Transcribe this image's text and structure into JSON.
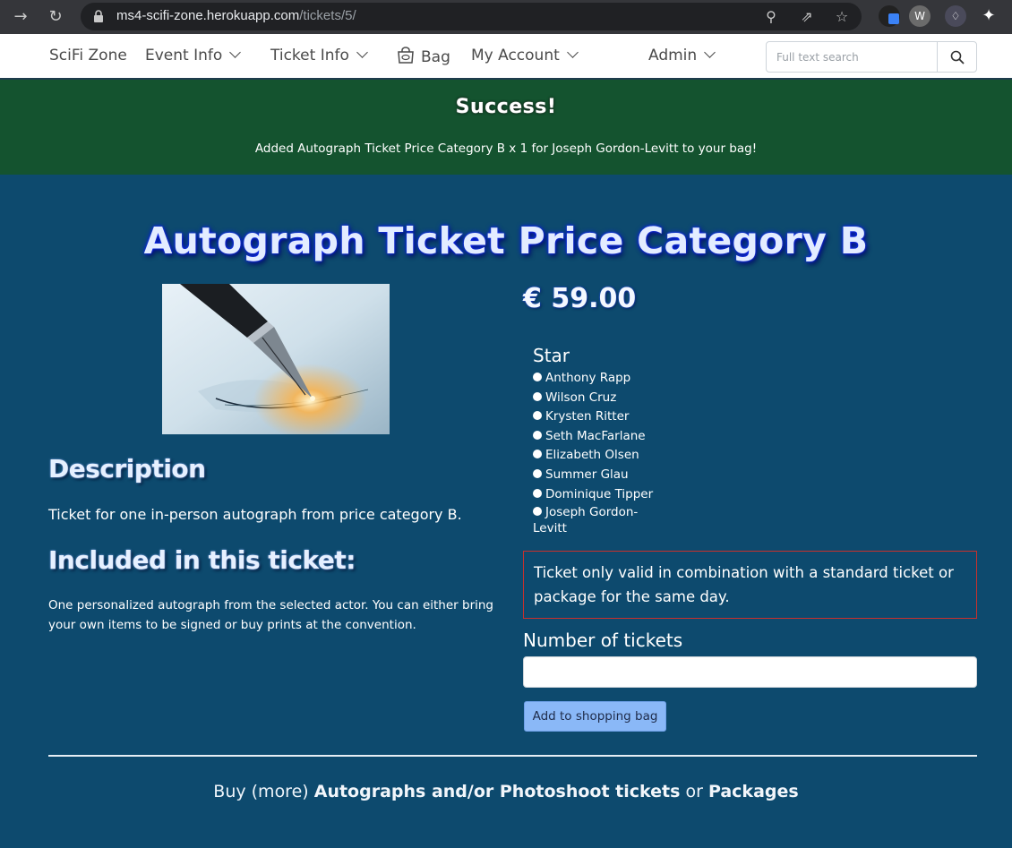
{
  "browser": {
    "url_host": "ms4-scifi-zone.herokuapp.com",
    "url_path": "/tickets/5/"
  },
  "navbar": {
    "brand": "SciFi Zone",
    "event_info": "Event Info",
    "ticket_info": "Ticket Info",
    "bag": "Bag",
    "my_account": "My Account",
    "admin": "Admin",
    "search_placeholder": "Full text search"
  },
  "alert": {
    "title": "Success!",
    "message": "Added Autograph Ticket Price Category B x 1 for Joseph Gordon-Levitt to your bag!"
  },
  "product": {
    "title": "Autograph Ticket Price Category B",
    "price": "€ 59.00",
    "description_heading": "Description",
    "description": "Ticket for one in-person autograph from price category B.",
    "included_heading": "Included in this ticket:",
    "included_text": "One personalized autograph from the selected actor. You can either bring your own items to be signed or buy prints at the convention.",
    "star_label": "Star",
    "stars": [
      "Anthony Rapp",
      "Wilson Cruz",
      "Krysten Ritter",
      "Seth MacFarlane",
      "Elizabeth Olsen",
      "Summer Glau",
      "Dominique Tipper",
      "Joseph Gordon-Levitt"
    ],
    "notice": "Ticket only valid in combination with a standard ticket or package for the same day.",
    "qty_label": "Number of tickets",
    "qty_value": "",
    "add_button": "Add to shopping bag"
  },
  "footer": {
    "prefix": "Buy (more) ",
    "link1": "Autographs and/or Photoshoot tickets",
    "middle": " or ",
    "link2": "Packages"
  }
}
